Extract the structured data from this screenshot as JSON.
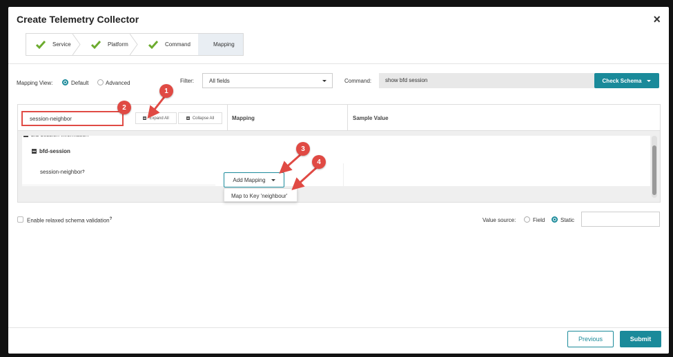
{
  "modal": {
    "title": "Create Telemetry Collector",
    "close": "×"
  },
  "steps": [
    {
      "label": "Service",
      "done": true
    },
    {
      "label": "Platform",
      "done": true
    },
    {
      "label": "Command",
      "done": true
    },
    {
      "label": "Mapping",
      "done": false,
      "active": true
    }
  ],
  "mapping_view": {
    "label": "Mapping View:",
    "default": "Default",
    "advanced": "Advanced",
    "selected": "Default"
  },
  "filter": {
    "label": "Filter:",
    "value": "All fields"
  },
  "command": {
    "label": "Command:",
    "value": "show bfd session",
    "check_schema": "Check Schema"
  },
  "table": {
    "search_value": "session-neighbor",
    "expand_all": "Expand All",
    "collapse_all": "Collapse All",
    "col_mapping": "Mapping",
    "col_sample": "Sample Value",
    "rows": {
      "truncated": "bfd-session-information",
      "group": "bfd-session",
      "leaf": "session-neighbor",
      "help": "?"
    },
    "add_mapping": "Add Mapping",
    "menu_item": "Map to Key 'neighbour'"
  },
  "relaxed": {
    "label": "Enable relaxed schema validation",
    "help": "?",
    "checked": false
  },
  "value_source": {
    "label": "Value source:",
    "field": "Field",
    "static": "Static",
    "selected": "Static",
    "value": ""
  },
  "footer": {
    "previous": "Previous",
    "submit": "Submit"
  },
  "annotations": [
    "1",
    "2",
    "3",
    "4"
  ],
  "colors": {
    "accent": "#1a8a9a",
    "callout": "#e04a44",
    "check": "#6cab2e"
  }
}
